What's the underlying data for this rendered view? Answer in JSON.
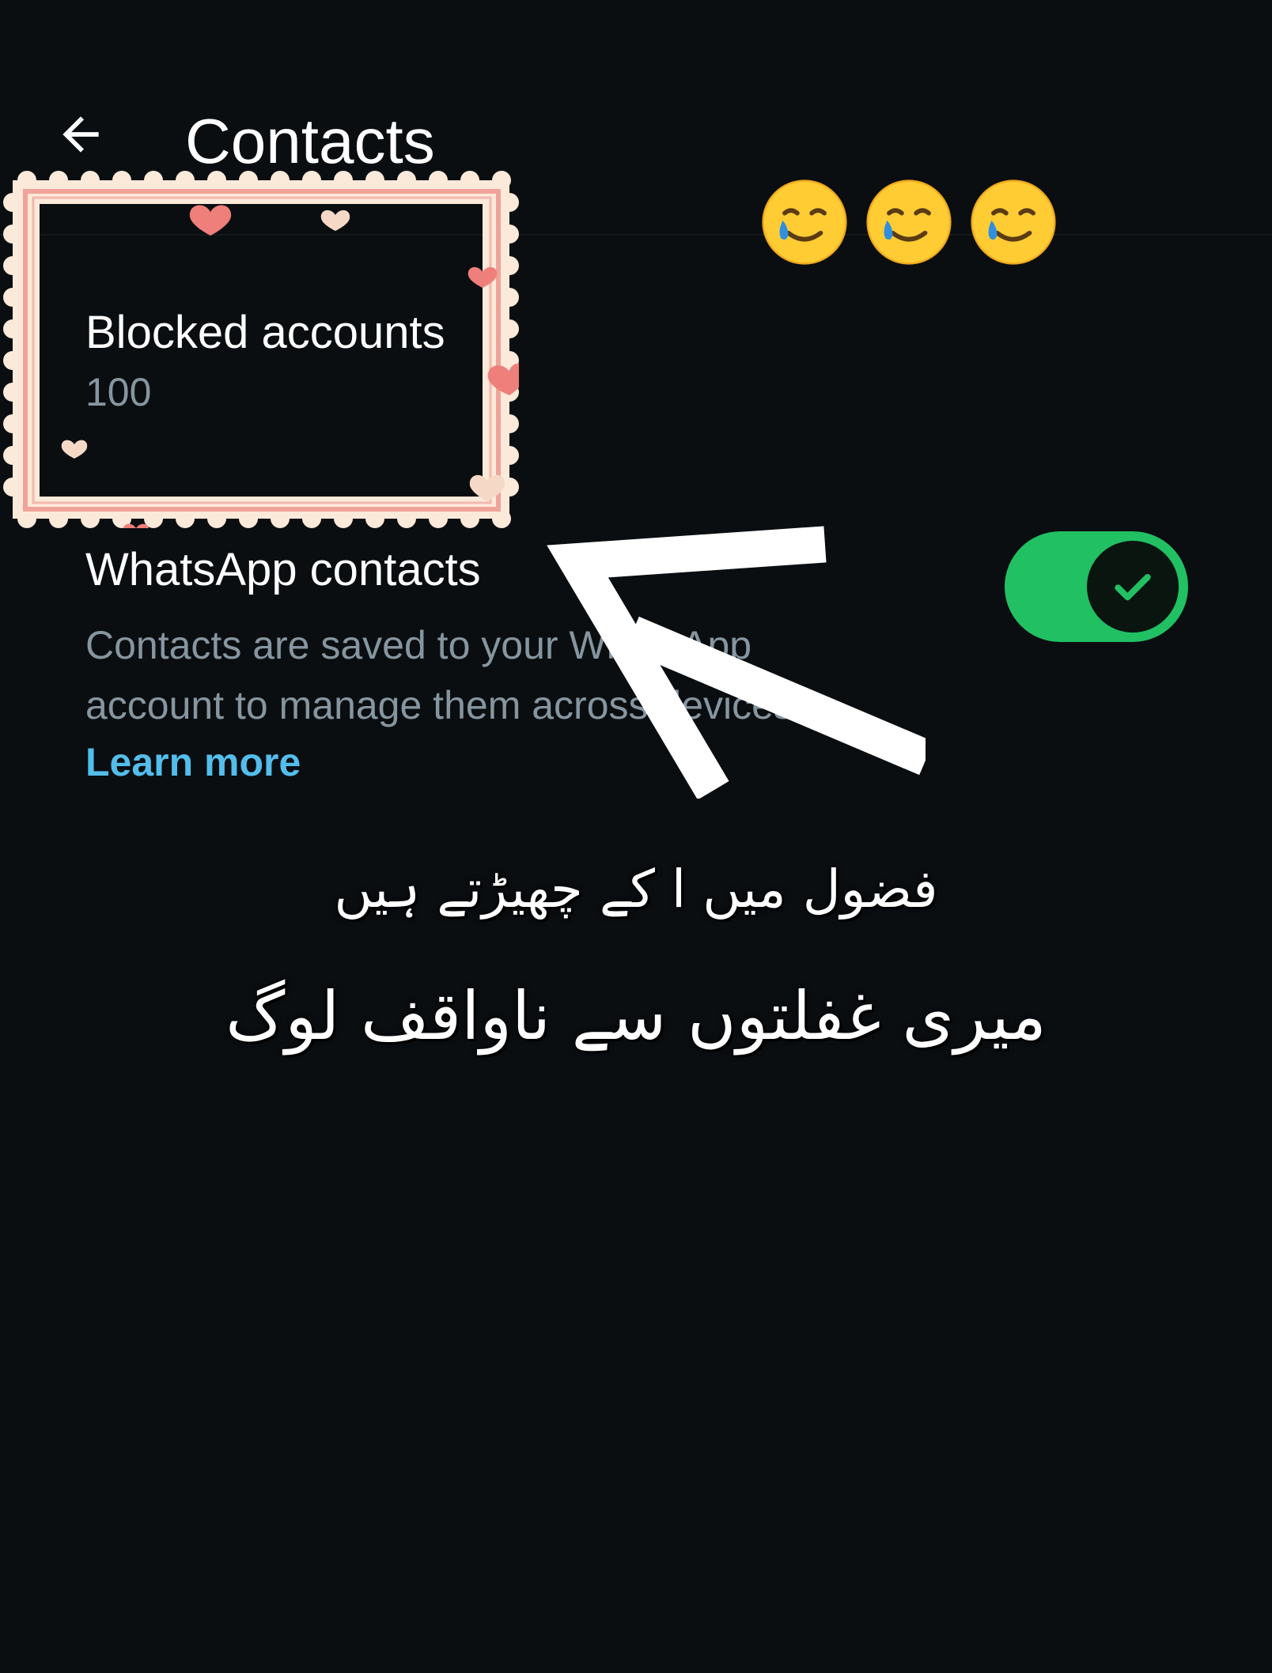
{
  "header": {
    "title": "Contacts",
    "back_icon": "arrow-left-icon"
  },
  "stickers": {
    "emoji": [
      "🥲",
      "🥲",
      "🥲"
    ],
    "emoji_name": "smiling-face-with-tear-icon",
    "frame": "stamp-frame-with-hearts",
    "frame_colors": {
      "paper": "#fbe9d9",
      "border": "#f0a39a",
      "heart": "#ef7f7a"
    }
  },
  "settings": {
    "blocked": {
      "title": "Blocked accounts",
      "count": "100"
    },
    "whatsapp_contacts": {
      "title": "WhatsApp contacts",
      "description": "Contacts are saved to your WhatsApp account to manage them across devices.",
      "learn_more": "Learn more",
      "toggle_on": true
    }
  },
  "overlay": {
    "arrow_icon": "hand-drawn-arrow-icon",
    "urdu_line_1": "فضول میں ا کے چھیڑتے ہیں",
    "urdu_line_2": "میری غفلتوں سے ناواقف لوگ"
  },
  "colors": {
    "background": "#0b0e11",
    "accent_green": "#21c063",
    "link_blue": "#53bdeb",
    "secondary_text": "#8696a0"
  }
}
